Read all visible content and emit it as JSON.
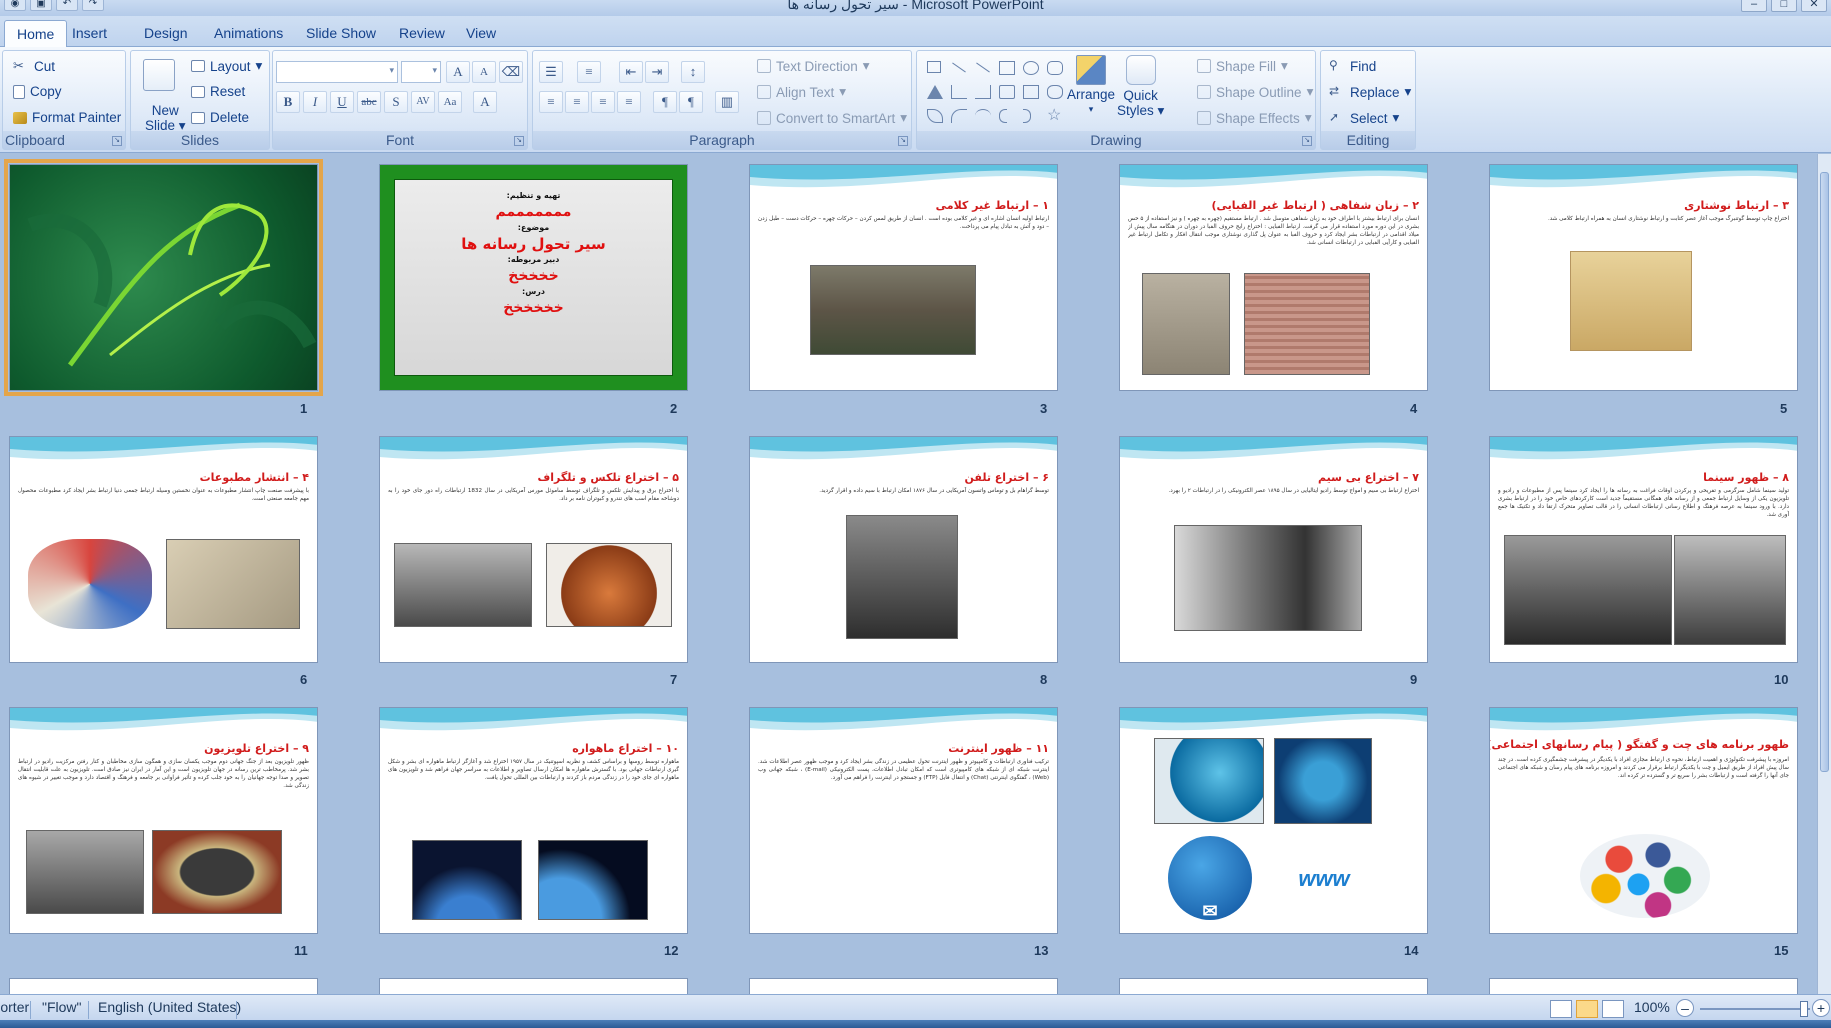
{
  "window": {
    "title": "سیر تحول رسانه ها  -  Microsoft PowerPoint"
  },
  "tabs": [
    "Home",
    "Insert",
    "Design",
    "Animations",
    "Slide Show",
    "Review",
    "View"
  ],
  "ribbon": {
    "clipboard": {
      "label": "Clipboard",
      "cut": "Cut",
      "copy": "Copy",
      "format_painter": "Format Painter"
    },
    "slides": {
      "label": "Slides",
      "new_slide_line1": "New",
      "new_slide_line2": "Slide",
      "layout": "Layout",
      "reset": "Reset",
      "delete": "Delete"
    },
    "font": {
      "label": "Font",
      "font_name": "",
      "font_size": ""
    },
    "paragraph": {
      "label": "Paragraph",
      "text_direction": "Text Direction",
      "align_text": "Align Text",
      "convert_smartart": "Convert to SmartArt"
    },
    "drawing": {
      "label": "Drawing",
      "arrange": "Arrange",
      "quick_styles_line1": "Quick",
      "quick_styles_line2": "Styles",
      "shape_fill": "Shape Fill",
      "shape_outline": "Shape Outline",
      "shape_effects": "Shape Effects"
    },
    "editing": {
      "label": "Editing",
      "find": "Find",
      "replace": "Replace",
      "select": "Select"
    }
  },
  "slides": [
    {
      "num": "1",
      "title": "",
      "kind": "cover-green"
    },
    {
      "num": "2",
      "kind": "title-slide",
      "lines": [
        "تهیه و تنظیم:",
        "مممممممم",
        "موضوع:",
        "سیر تحول رسانه ها",
        "دبیر مربوطه:",
        "خخخخخ",
        "درس:",
        "خخخخخخ"
      ]
    },
    {
      "num": "3",
      "title": "۱ – ارتباط غیر کلامی",
      "body": "ارتباط اولیه انسان اشاره ای و غیر کلامی بوده است . انسان از طریق لمس کردن – حرکات چهره – حرکات دست – طبل زدن – دود و آتش به تبادل پیام می پرداخت."
    },
    {
      "num": "4",
      "title": "۲ – زبان شفاهی ( ارتباط غیر الفبایی)",
      "body": "انسان برای ارتباط بیشتر با اطراف خود به زبان شفاهی متوسل شد . ارتباط مستقیم (چهره به چهره ) و نیز استفاده از ۵ حس بشری در این دوره مورد استفاده قرار می گرفت. ارتباط الفبایی : اختراع رایج حروف الفبا در دوران در هنگامه سال پیش از میلاد اقدامی در ارتباطات بشر ایجاد کرد و حروف الفبا به عنوان پل گذاری نوشتاری موجب انتقال افکار و تکامل ارتباط غیر الفبایی و کارآیی الفبایی در ارتباطات انسانی شد."
    },
    {
      "num": "5",
      "title": "۳ – ارتباط نوشتاری",
      "body": "اختراع چاپ توسط گوتنبرگ موجب آغاز عصر کتابت و ارتباط نوشتاری انسان به همراه ارتباط کلامی شد."
    },
    {
      "num": "6",
      "title": "۴ – انتشار مطبوعات",
      "body": "با پیشرفت صنعت چاپ انتشار مطبوعات به عنوان نخستین وسیله ارتباط جمعی دنیا ارتباط بشر ایجاد کرد مطبوعات محصول مهم جامعه صنعتی است."
    },
    {
      "num": "7",
      "title": "۵ – اختراع تلکس و تلگراف",
      "body": "با اختراع برق و پیدایش تلکس و تلگراف توسط ساموئل مورس آمریکایی در سال 1832 ارتباطات راه دور جای خود را به دوشاخه مقام اسب های تندرو و کبوتران نامه بر داد."
    },
    {
      "num": "8",
      "title": "۶ – اختراع تلفن",
      "body": "توسط گراهام بل و توماس واتسون آمریکایی در سال ۱۸۷۶ امکان ارتباط با سیم داده و اقرار گردید."
    },
    {
      "num": "9",
      "title": "۷ – اختراع بی سیم",
      "body": "اختراع ارتباط بی سیم و امواج توسط رادیو ایتالیایی در سال ۱۸۹۵ عصر الکترونیکی را در ارتباطات ۲ را بهرد."
    },
    {
      "num": "10",
      "title": "۸ – ظهور سینما",
      "body": "تولید سینما شامل سرگرمی و تفریحی و پرکردن اوقات فراغت به رسانه ها را ایجاد کرد سینما پس از مطبوعات و رادیو و تلویزیون یکی از وسایل ارتباط جمعی و از رسانه های همگانی مستقیماً جدید است کارکردهای خاص خود را در ارتباط بشری دارد. با ورود سینما به عرصه فرهنگ و اطلاع رسانی ارتباطات انسانی را در قالب تصاویر متحرک ارتقا داد و تکنیک ها جمع آوری شد."
    },
    {
      "num": "11",
      "title": "۹ – اختراع تلویزیون",
      "body": "ظهور تلویزیون بعد از جنگ جهانی دوم موجب یکسان سازی و همگون سازی مخاطبان و کنار رفتن مرکزیت رادیو در ارتباط بشر شد. پرمخاطب ترین رسانه در جهان تلویزیون است و این آمار در ایران نیز صادق است. تلویزیون به علت قابلیت انتقال تصویر و صدا توجه جهانیان را به خود جلب کرده و تأثیر فراوانی بر جامعه و فرهنگ و اقتصاد دارد و موجب تغییر در شیوه های زندگی شد."
    },
    {
      "num": "12",
      "title": "۱۰ – اختراع ماهواره",
      "body": "ماهواره توسط روسها و براساس کشف و نظریه اسپوتنیک در سال ۱۹۵۷ اختراع شد و آغازگر ارتباط ماهواره ای بشر و شکل گیری ارتباطات جهانی بود. با گسترش ماهواره ها امکان ارسال تصاویر و اطلاعات به سراسر جهان فراهم شد و تلویزیون های ماهواره ای جای خود را در زندگی مردم باز کردند و ارتباطات بین المللی تحول یافت."
    },
    {
      "num": "13",
      "title": "۱۱ – ظهور اینترنت",
      "body": "ترکیب فناوری ارتباطات و کامپیوتر و ظهور اینترنت تحول عظیمی در زندگی بشر ایجاد کرد و موجب ظهور عصر اطلاعات شد. اینترنت شبکه ای از شبکه های کامپیوتری است که امکان تبادل اطلاعات، پست الکترونیکی (E-mail) ، شبکه جهانی وب (Web) ، گفتگوی اینترنتی (Chat) و انتقال فایل (FTP) و جستجو در اینترنت را فراهم می آورد."
    },
    {
      "num": "14",
      "title": "",
      "kind": "icons"
    },
    {
      "num": "15",
      "title": "ظهور برنامه های چت و گفتگو ( پیام رسانهای اجتماعی)",
      "body": "امروزه با پیشرفت تکنولوژی و اهمیت ارتباط، نحوه ی ارتباط مجازی افراد با یکدیگر در پیشرفت چشمگیری کرده است. در چند سال پیش افراد از طریق ایمیل و چت با یکدیگر ارتباط برقرار می کردند و امروزه برنامه های پیام رسان و شبکه های اجتماعی جای آنها را گرفته است و ارتباطات بشر را سریع تر و گسترده تر کرده اند."
    }
  ],
  "status": {
    "view": "Slide Sorter",
    "theme": "\"Flow\"",
    "language": "English (United States)",
    "zoom": "100%"
  }
}
